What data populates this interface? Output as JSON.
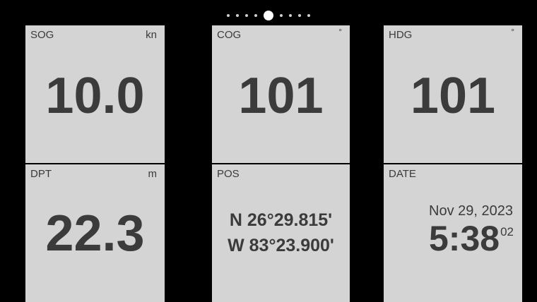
{
  "pager": {
    "page_count": 9,
    "active_index": 4
  },
  "tiles": {
    "sog": {
      "label": "SOG",
      "unit": "kn",
      "value": "10.0"
    },
    "cog": {
      "label": "COG",
      "unit": "°",
      "value": "101"
    },
    "hdg": {
      "label": "HDG",
      "unit": "°",
      "value": "101"
    },
    "dpt": {
      "label": "DPT",
      "unit": "m",
      "value": "22.3"
    },
    "pos": {
      "label": "POS",
      "lat": "N 26°29.815'",
      "lon": "W 83°23.900'"
    },
    "date": {
      "label": "DATE",
      "date": "Nov 29, 2023",
      "time": "5:38",
      "seconds": "02"
    }
  },
  "colors": {
    "background": "#000000",
    "tile": "#d4d4d4",
    "text": "#3b3b3b",
    "dot": "#cfcfcf",
    "dot_active": "#ffffff"
  }
}
